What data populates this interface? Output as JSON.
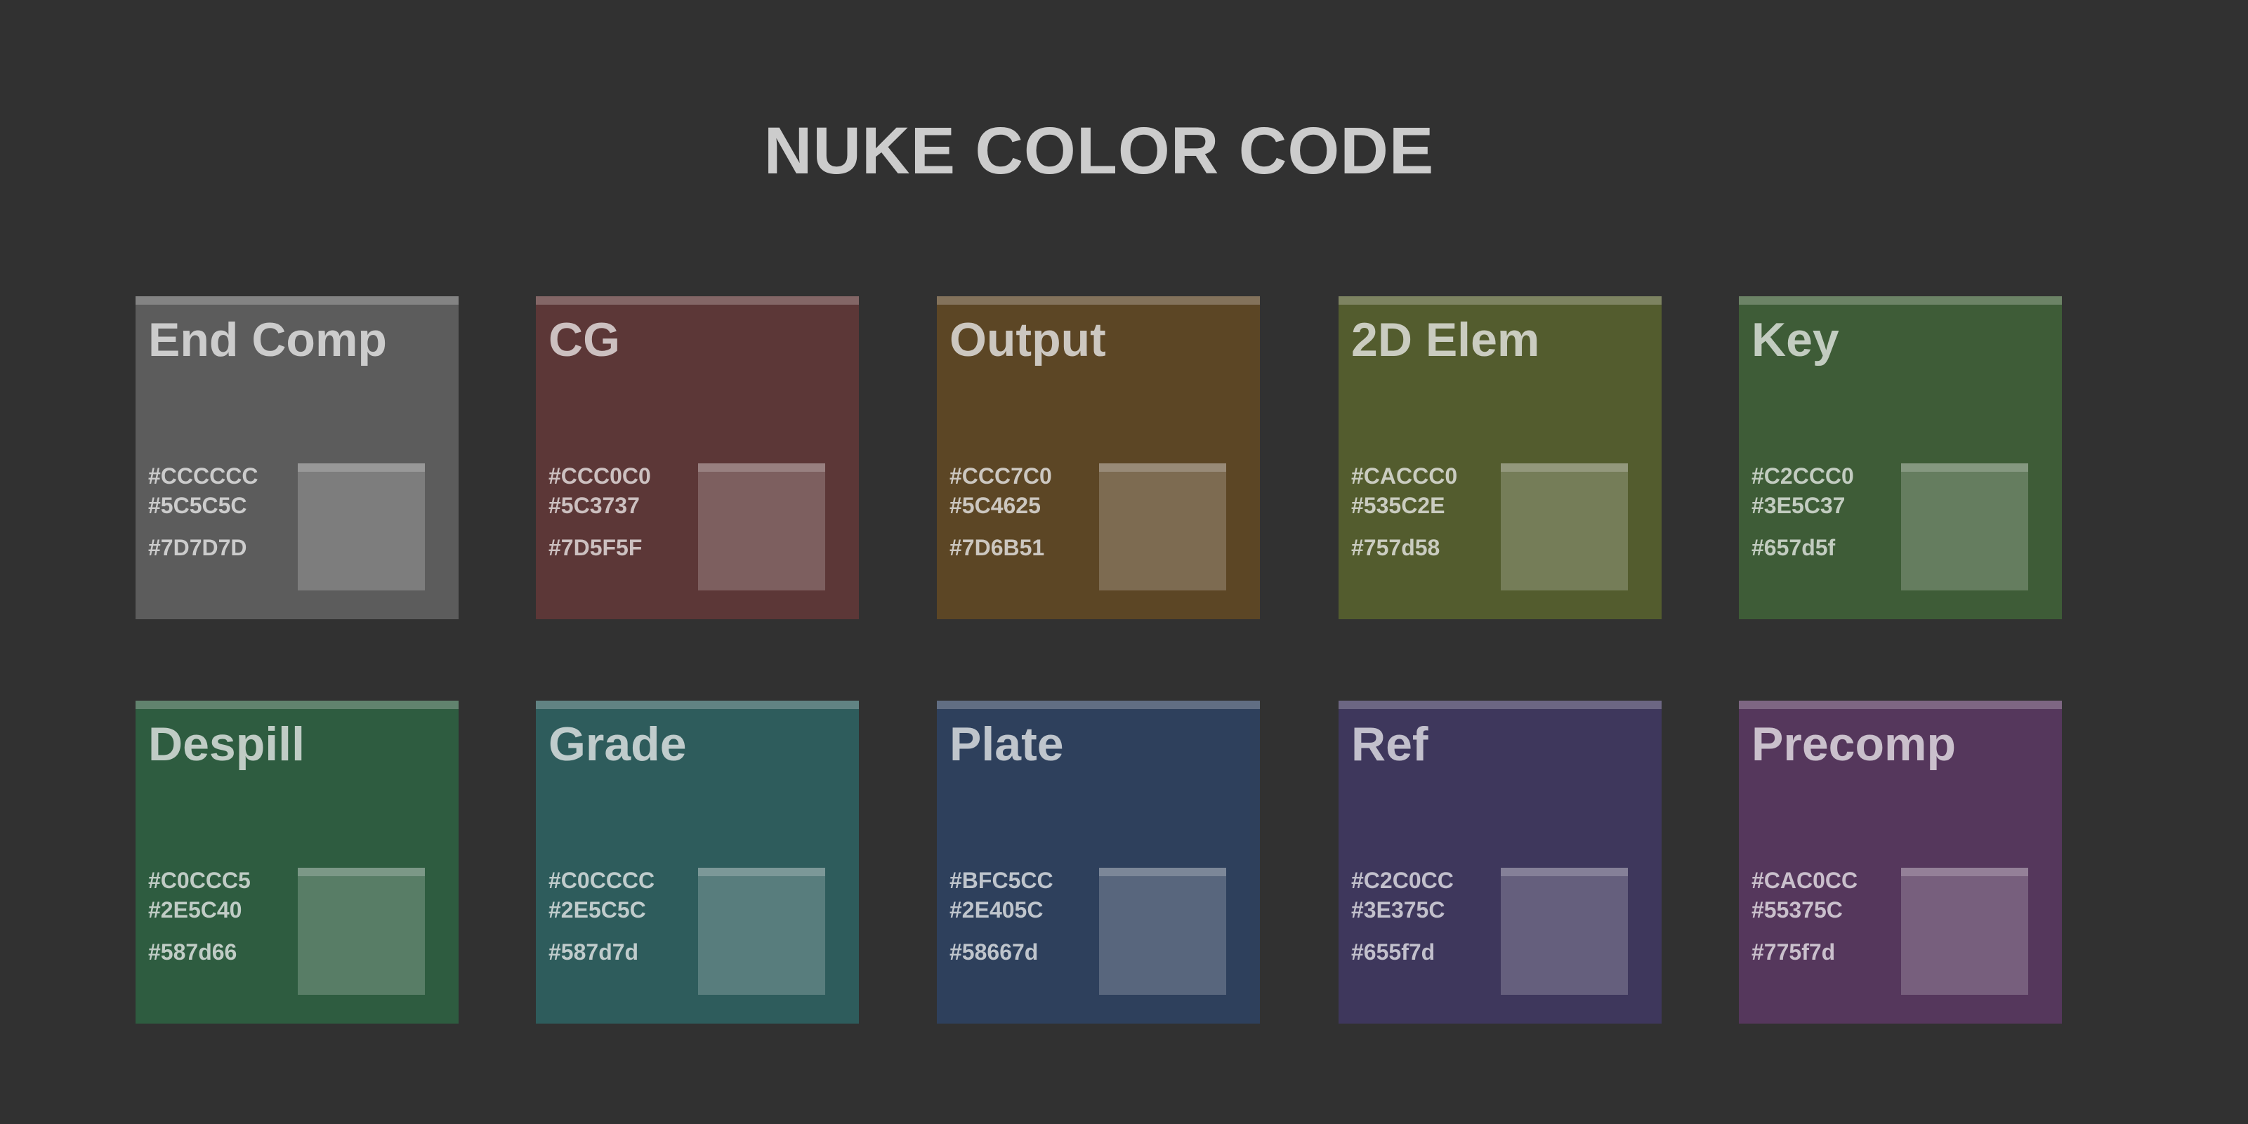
{
  "title": "NUKE COLOR CODE",
  "colors": {
    "background": "#313131",
    "title_text": "#CCCCCC"
  },
  "cards": [
    {
      "name": "End Comp",
      "text": "#CCCCCC",
      "body": "#5C5C5C",
      "swatch": "#7D7D7D",
      "codes": [
        "#CCCCCC",
        "#5C5C5C",
        "#7D7D7D"
      ]
    },
    {
      "name": "CG",
      "text": "#CCC0C0",
      "body": "#5C3737",
      "swatch": "#7D5F5F",
      "codes": [
        "#CCC0C0",
        "#5C3737",
        "#7D5F5F"
      ]
    },
    {
      "name": "Output",
      "text": "#CCC7C0",
      "body": "#5C4625",
      "swatch": "#7D6B51",
      "codes": [
        "#CCC7C0",
        "#5C4625",
        "#7D6B51"
      ]
    },
    {
      "name": "2D Elem",
      "text": "#CACCC0",
      "body": "#535C2E",
      "swatch": "#757d58",
      "codes": [
        "#CACCC0",
        "#535C2E",
        "#757d58"
      ]
    },
    {
      "name": "Key",
      "text": "#C2CCC0",
      "body": "#3E5C37",
      "swatch": "#657d5f",
      "codes": [
        "#C2CCC0",
        "#3E5C37",
        "#657d5f"
      ]
    },
    {
      "name": "Despill",
      "text": "#C0CCC5",
      "body": "#2E5C40",
      "swatch": "#587d66",
      "codes": [
        "#C0CCC5",
        "#2E5C40",
        "#587d66"
      ]
    },
    {
      "name": "Grade",
      "text": "#C0CCCC",
      "body": "#2E5C5C",
      "swatch": "#587d7d",
      "codes": [
        "#C0CCCC",
        "#2E5C5C",
        "#587d7d"
      ]
    },
    {
      "name": "Plate",
      "text": "#BFC5CC",
      "body": "#2E405C",
      "swatch": "#58667d",
      "codes": [
        "#BFC5CC",
        "#2E405C",
        "#58667d"
      ]
    },
    {
      "name": "Ref",
      "text": "#C2C0CC",
      "body": "#3E375C",
      "swatch": "#655f7d",
      "codes": [
        "#C2C0CC",
        "#3E375C",
        "#655f7d"
      ]
    },
    {
      "name": "Precomp",
      "text": "#CAC0CC",
      "body": "#55375C",
      "swatch": "#775f7d",
      "codes": [
        "#CAC0CC",
        "#55375C",
        "#775f7d"
      ]
    }
  ]
}
